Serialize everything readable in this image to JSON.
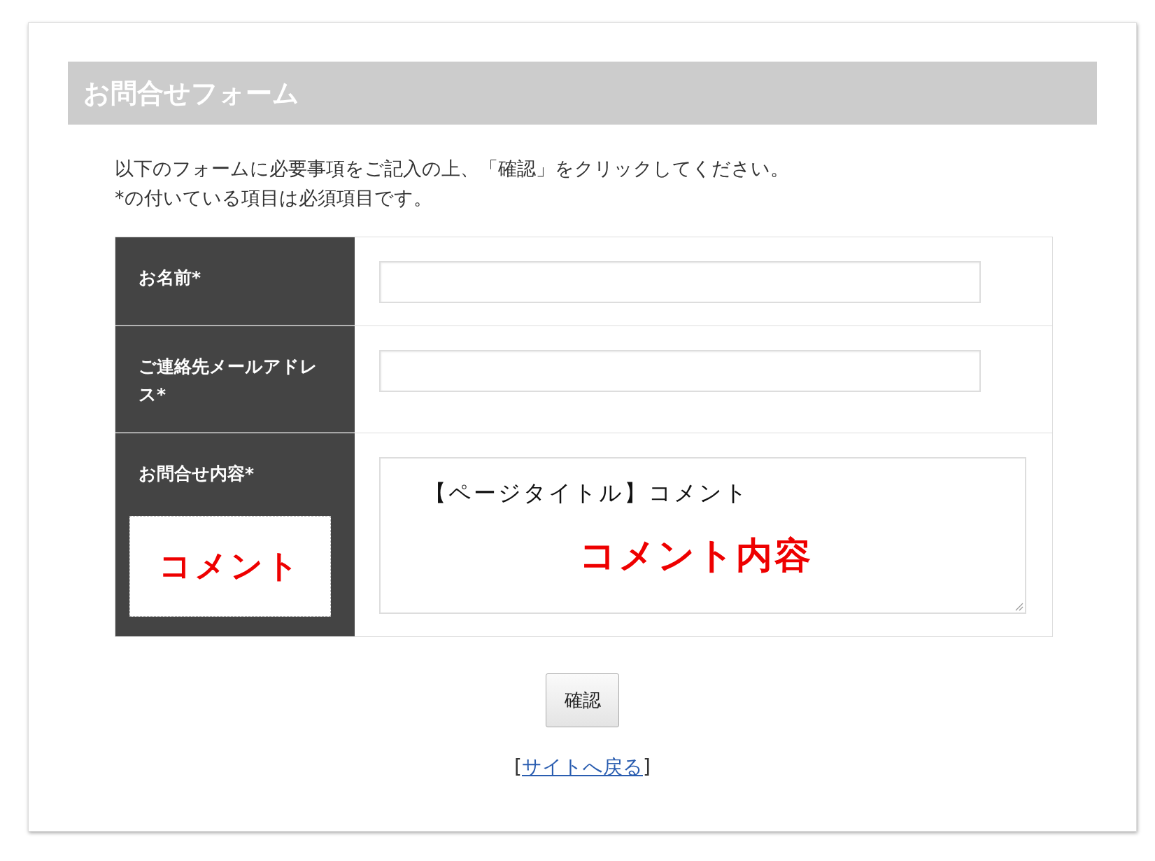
{
  "header": {
    "title": "お問合せフォーム"
  },
  "intro": [
    "以下のフォームに必要事項をご記入の上、「確認」をクリックしてください。",
    "*の付いている項目は必須項目です。"
  ],
  "fields": [
    {
      "label": "お名前*",
      "kind": "text"
    },
    {
      "label": "ご連絡先メールアドレス*",
      "kind": "text"
    },
    {
      "label": "お問合せ内容*",
      "kind": "textarea",
      "value": "【ページタイトル】コメント",
      "annotation": "コメント",
      "value_annotation": "コメント内容"
    }
  ],
  "submit_button": "確認",
  "back_link": {
    "open": "[",
    "label": "サイトへ戻る",
    "close": "]"
  }
}
